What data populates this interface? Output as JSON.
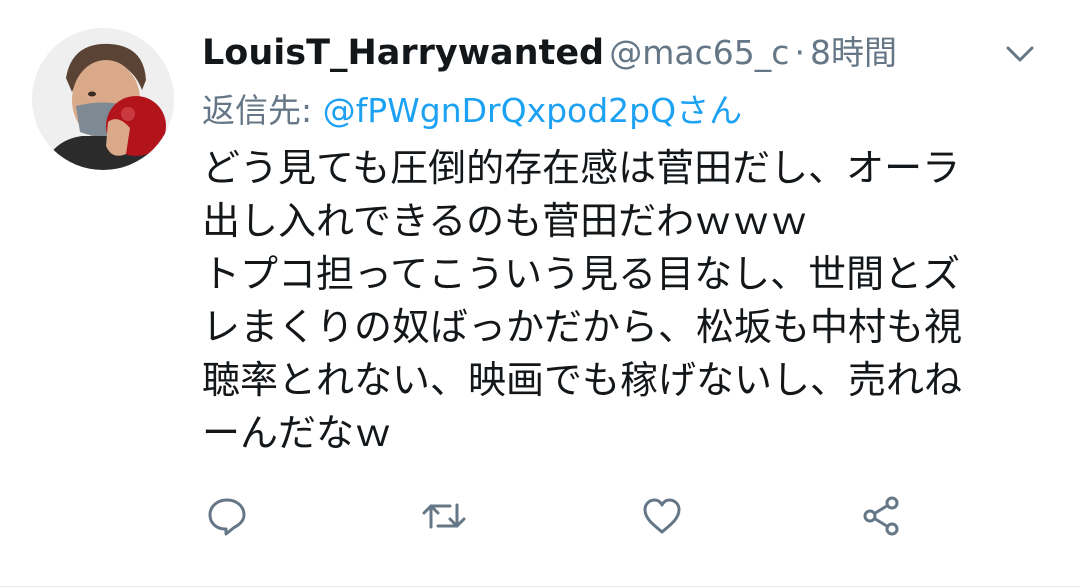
{
  "tweet": {
    "user": {
      "display_name": "LouisT_Harrywanted",
      "handle": "@mac65_c",
      "avatar_icon": "profile-photo"
    },
    "separator": "·",
    "time": "8時間",
    "reply": {
      "prefix": "返信先: ",
      "mention": "@fPWgnDrQxpod2pQさん"
    },
    "text_lines": [
      "どう見ても圧倒的存在感は菅田だし、オーラ",
      "出し入れできるのも菅田だわｗｗｗ",
      "トプコ担ってこういう見る目なし、世間とズ",
      "レまくりの奴ばっかだから、松坂も中村も視",
      "聴率とれない、映画でも稼げないし、売れね",
      "ーんだなｗ"
    ],
    "actions": [
      {
        "name": "reply",
        "icon": "speech-bubble-icon"
      },
      {
        "name": "retweet",
        "icon": "retweet-icon"
      },
      {
        "name": "like",
        "icon": "heart-icon"
      },
      {
        "name": "share",
        "icon": "share-icon"
      }
    ]
  },
  "colors": {
    "text_primary": "#14171a",
    "text_secondary": "#657786",
    "link": "#1da1f2",
    "icon": "#657786",
    "divider": "#e6ecf0"
  }
}
